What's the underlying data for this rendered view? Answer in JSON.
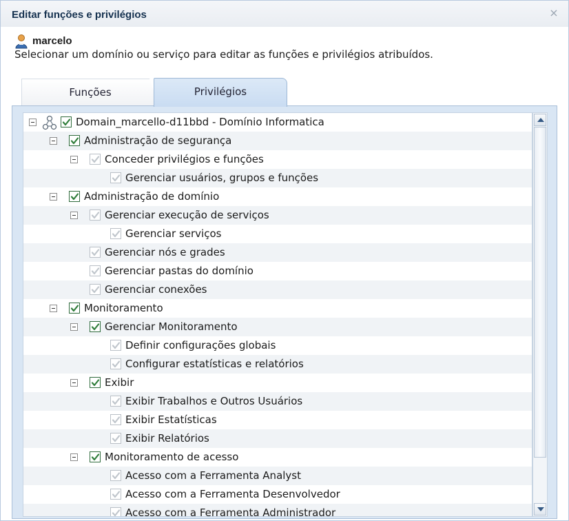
{
  "dialog": {
    "title": "Editar funções e privilégios",
    "close_label": "×"
  },
  "user": {
    "name": "marcelo",
    "instructions": "Selecionar um domínio ou serviço para editar as funções e privilégios atribuídos."
  },
  "tabs": [
    {
      "label": "Funções",
      "active": false
    },
    {
      "label": "Privilégios",
      "active": true
    }
  ],
  "tree": {
    "rows": [
      {
        "label": "Domain_marcello-d11bbd - Domínio Informatica",
        "level": 0,
        "expander": true,
        "checked": true,
        "enabled": true,
        "icon": "domain-icon"
      },
      {
        "label": "Administração de segurança",
        "level": 1,
        "expander": true,
        "checked": true,
        "enabled": true
      },
      {
        "label": "Conceder privilégios e funções",
        "level": 2,
        "expander": true,
        "checked": true,
        "enabled": false
      },
      {
        "label": "Gerenciar usuários, grupos e funções",
        "level": 3,
        "expander": false,
        "checked": true,
        "enabled": false
      },
      {
        "label": "Administração de domínio",
        "level": 1,
        "expander": true,
        "checked": true,
        "enabled": true
      },
      {
        "label": "Gerenciar execução de serviços",
        "level": 2,
        "expander": true,
        "checked": true,
        "enabled": false
      },
      {
        "label": "Gerenciar serviços",
        "level": 3,
        "expander": false,
        "checked": true,
        "enabled": false
      },
      {
        "label": "Gerenciar nós e grades",
        "level": 2,
        "expander": false,
        "checked": true,
        "enabled": false
      },
      {
        "label": "Gerenciar pastas do domínio",
        "level": 2,
        "expander": false,
        "checked": true,
        "enabled": false
      },
      {
        "label": "Gerenciar conexões",
        "level": 2,
        "expander": false,
        "checked": true,
        "enabled": false
      },
      {
        "label": "Monitoramento",
        "level": 1,
        "expander": true,
        "checked": true,
        "enabled": true
      },
      {
        "label": "Gerenciar Monitoramento",
        "level": 2,
        "expander": true,
        "checked": true,
        "enabled": true
      },
      {
        "label": "Definir configurações globais",
        "level": 3,
        "expander": false,
        "checked": true,
        "enabled": false
      },
      {
        "label": "Configurar estatísticas e relatórios",
        "level": 3,
        "expander": false,
        "checked": true,
        "enabled": false
      },
      {
        "label": "Exibir",
        "level": 2,
        "expander": true,
        "checked": true,
        "enabled": true
      },
      {
        "label": "Exibir Trabalhos e Outros Usuários",
        "level": 3,
        "expander": false,
        "checked": true,
        "enabled": false
      },
      {
        "label": "Exibir Estatísticas",
        "level": 3,
        "expander": false,
        "checked": true,
        "enabled": false
      },
      {
        "label": "Exibir Relatórios",
        "level": 3,
        "expander": false,
        "checked": true,
        "enabled": false
      },
      {
        "label": "Monitoramento de acesso",
        "level": 2,
        "expander": true,
        "checked": true,
        "enabled": true
      },
      {
        "label": "Acesso com a Ferramenta Analyst",
        "level": 3,
        "expander": false,
        "checked": true,
        "enabled": false
      },
      {
        "label": "Acesso com a Ferramenta Desenvolvedor",
        "level": 3,
        "expander": false,
        "checked": true,
        "enabled": false
      },
      {
        "label": "Acesso com a Ferramenta Administrador",
        "level": 3,
        "expander": false,
        "checked": true,
        "enabled": false
      }
    ]
  },
  "colors": {
    "check_enabled": "#2f7d3a",
    "check_disabled": "#c0c6cc",
    "accent_tab": "#c9dcf2"
  }
}
